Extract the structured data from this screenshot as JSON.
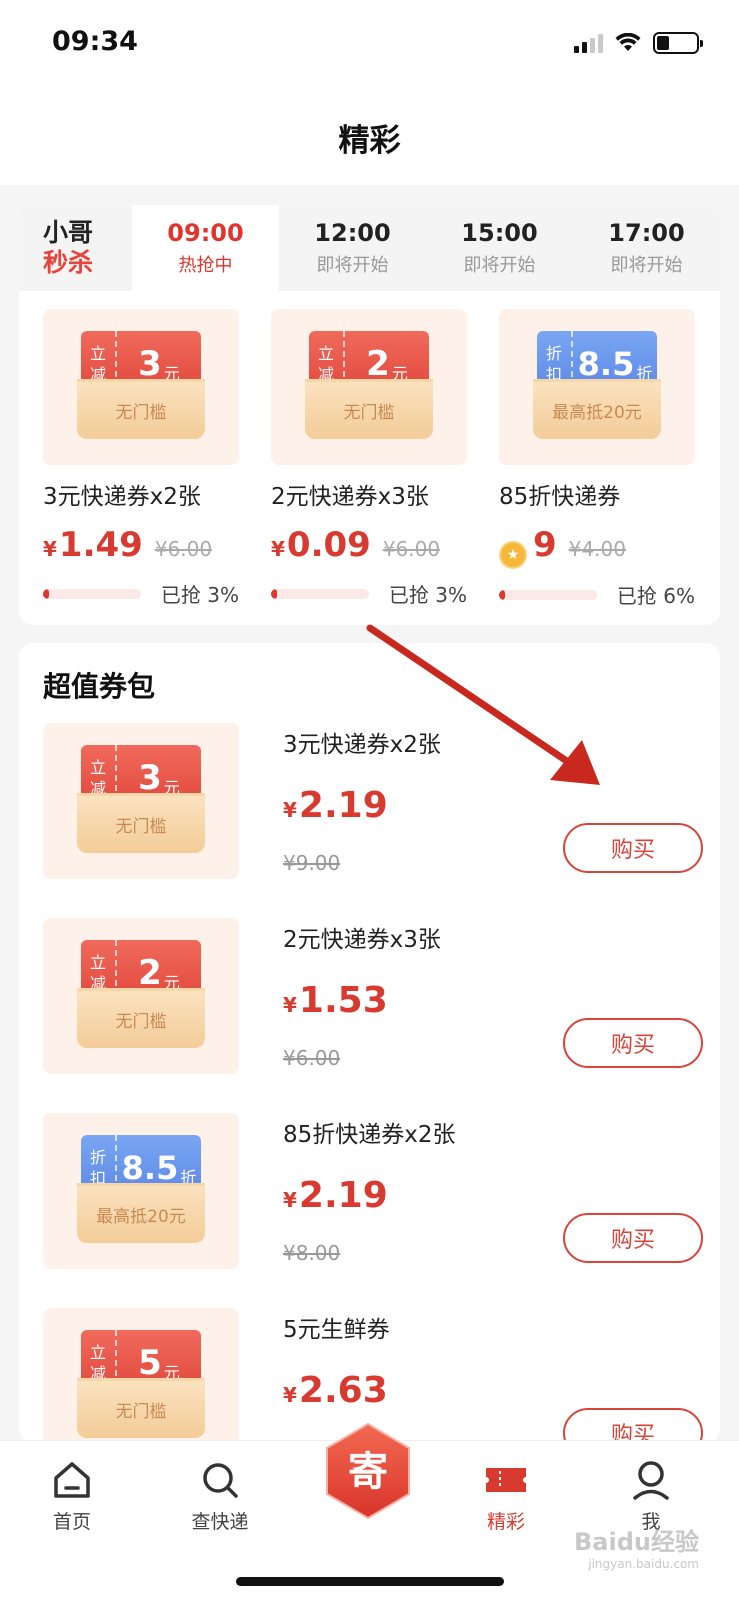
{
  "status_bar": {
    "time": "09:34"
  },
  "header": {
    "title": "精彩"
  },
  "flash_sale": {
    "logo_line1": "小哥",
    "logo_line2": "秒杀",
    "tabs": [
      {
        "time": "09:00",
        "status": "热抢中",
        "active": true
      },
      {
        "time": "12:00",
        "status": "即将开始",
        "active": false
      },
      {
        "time": "15:00",
        "status": "即将开始",
        "active": false
      },
      {
        "time": "17:00",
        "status": "即将开始",
        "active": false
      }
    ],
    "items": [
      {
        "coupon_left_top": "立",
        "coupon_left_bottom": "减",
        "coupon_value": "3",
        "coupon_unit": "元",
        "envelope_text": "无门槛",
        "name": "3元快递券x2张",
        "price_symbol": "¥",
        "price": "1.49",
        "old_price": "¥6.00",
        "progress_text": "已抢 3%",
        "progress": 0.03
      },
      {
        "coupon_left_top": "立",
        "coupon_left_bottom": "减",
        "coupon_value": "2",
        "coupon_unit": "元",
        "envelope_text": "无门槛",
        "name": "2元快递券x3张",
        "price_symbol": "¥",
        "price": "0.09",
        "old_price": "¥6.00",
        "progress_text": "已抢 3%",
        "progress": 0.03
      },
      {
        "coupon_left_top": "折",
        "coupon_left_bottom": "扣",
        "coupon_value": "8.5",
        "coupon_unit": "折",
        "envelope_text": "最高抵20元",
        "name": "85折快递券",
        "price": "9",
        "old_price": "¥4.00",
        "progress_text": "已抢 6%",
        "progress": 0.06
      }
    ]
  },
  "bundle": {
    "title": "超值券包",
    "buy_label": "购买",
    "items": [
      {
        "coupon_left_top": "立",
        "coupon_left_bottom": "减",
        "coupon_value": "3",
        "coupon_unit": "元",
        "envelope_text": "无门槛",
        "name": "3元快递券x2张",
        "price_symbol": "¥",
        "price": "2.19",
        "old_price": "¥9.00"
      },
      {
        "coupon_left_top": "立",
        "coupon_left_bottom": "减",
        "coupon_value": "2",
        "coupon_unit": "元",
        "envelope_text": "无门槛",
        "name": "2元快递券x3张",
        "price_symbol": "¥",
        "price": "1.53",
        "old_price": "¥6.00"
      },
      {
        "coupon_left_top": "折",
        "coupon_left_bottom": "扣",
        "coupon_value": "8.5",
        "coupon_unit": "折",
        "envelope_text": "最高抵20元",
        "name": "85折快递券x2张",
        "price_symbol": "¥",
        "price": "2.19",
        "old_price": "¥8.00"
      },
      {
        "coupon_left_top": "立",
        "coupon_left_bottom": "减",
        "coupon_value": "5",
        "coupon_unit": "元",
        "envelope_text": "无门槛",
        "name": "5元生鲜券",
        "price_symbol": "¥",
        "price": "2.63",
        "old_price": ""
      }
    ]
  },
  "tab_bar": {
    "home": "首页",
    "track": "查快递",
    "send_glyph": "寄",
    "featured": "精彩",
    "me": "我"
  },
  "watermark": {
    "main": "Baidu经验",
    "sub": "jingyan.baidu.com"
  },
  "colors": {
    "accent": "#d83a30",
    "coupon_red": "#e0463a",
    "coupon_blue": "#5a86e6",
    "envelope": "#f3cc98"
  }
}
